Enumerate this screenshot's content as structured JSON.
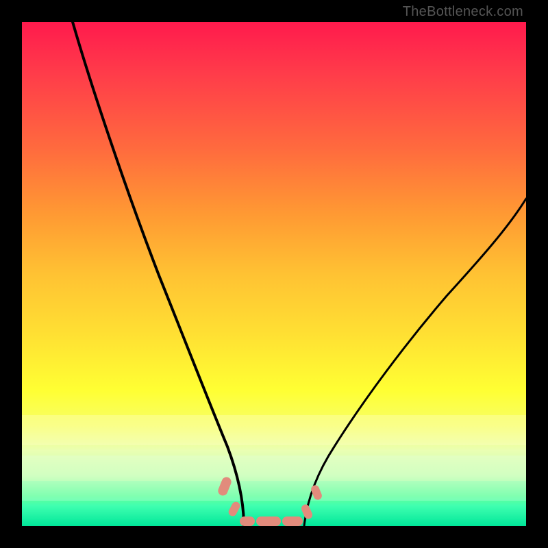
{
  "watermark": "TheBottleneck.com",
  "chart_data": {
    "type": "line",
    "title": "",
    "xlabel": "",
    "ylabel": "",
    "xlim": [
      0,
      100
    ],
    "ylim": [
      0,
      100
    ],
    "grid": false,
    "legend": false,
    "series": [
      {
        "name": "left-descending-curve",
        "color": "#000000",
        "x": [
          10,
          14,
          18,
          22,
          26,
          30,
          34,
          38,
          41,
          43,
          44
        ],
        "y": [
          100,
          88,
          73,
          58,
          44,
          32,
          22,
          14,
          7,
          3,
          0
        ]
      },
      {
        "name": "right-ascending-curve",
        "color": "#000000",
        "x": [
          56,
          58,
          62,
          66,
          72,
          80,
          90,
          100
        ],
        "y": [
          0,
          6,
          14,
          22,
          32,
          44,
          56,
          65
        ]
      },
      {
        "name": "bottom-flat-segment",
        "color": "#000000",
        "x": [
          44,
          56
        ],
        "y": [
          0,
          0
        ]
      }
    ],
    "markers": [
      {
        "name": "left-cluster",
        "shape": "rounded-rect",
        "color": "#e28b7c",
        "points": [
          [
            40,
            8
          ],
          [
            41.5,
            4
          ]
        ]
      },
      {
        "name": "bottom-cluster",
        "shape": "rounded-rect",
        "color": "#e28b7c",
        "points": [
          [
            44.5,
            0.5
          ],
          [
            48,
            0.5
          ],
          [
            52,
            0.5
          ],
          [
            55,
            0.5
          ]
        ]
      },
      {
        "name": "right-cluster",
        "shape": "rounded-rect",
        "color": "#e28b7c",
        "points": [
          [
            57,
            3
          ],
          [
            58.5,
            7
          ]
        ]
      }
    ],
    "background": {
      "type": "vertical-gradient",
      "stops": [
        {
          "pos": 0.0,
          "hex": "#ff1a4d"
        },
        {
          "pos": 0.25,
          "hex": "#ff6a3e"
        },
        {
          "pos": 0.5,
          "hex": "#ffc233"
        },
        {
          "pos": 0.73,
          "hex": "#ffff33"
        },
        {
          "pos": 0.9,
          "hex": "#c6ffb3"
        },
        {
          "pos": 1.0,
          "hex": "#00e699"
        }
      ]
    }
  }
}
